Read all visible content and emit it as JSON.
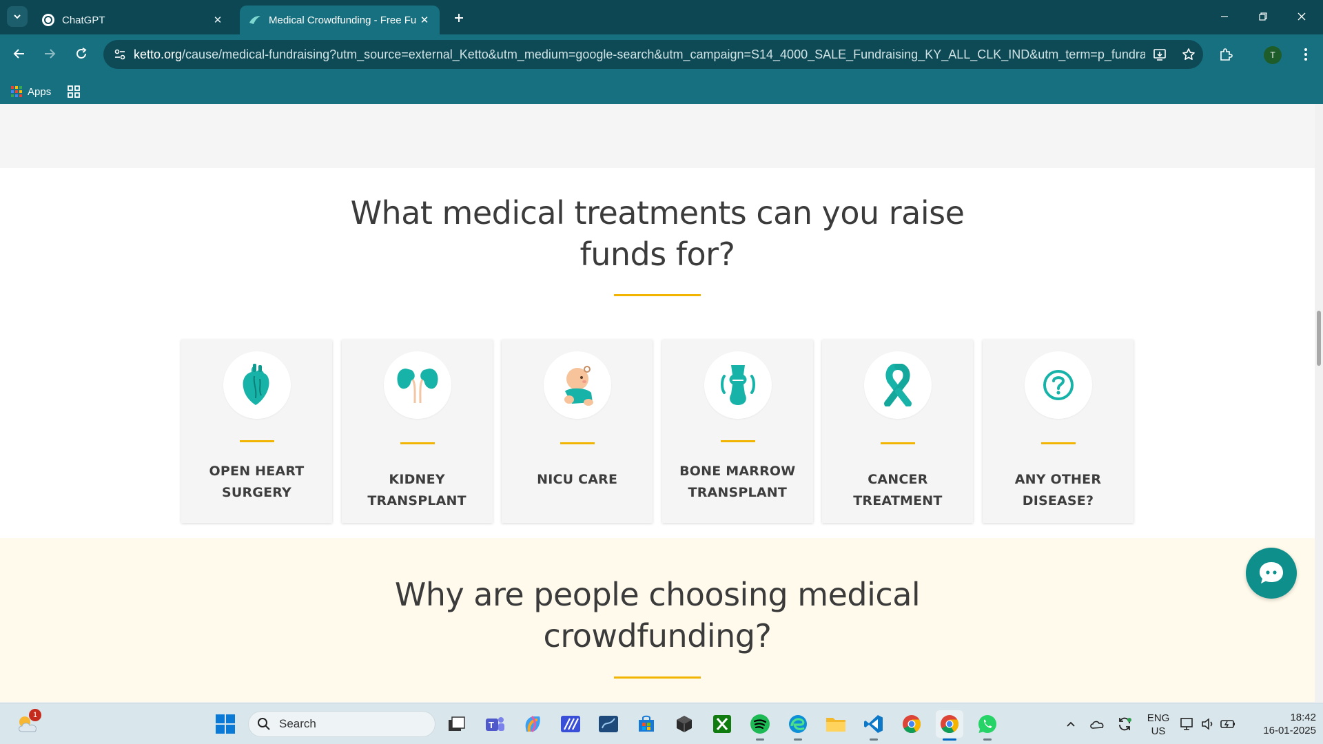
{
  "browser": {
    "tabs": [
      {
        "title": "ChatGPT",
        "active": false
      },
      {
        "title": "Medical Crowdfunding - Free Fu",
        "active": true
      }
    ],
    "url_host": "ketto.org",
    "url_path": "/cause/medical-fundraising?utm_source=external_Ketto&utm_medium=google-search&utm_campaign=S14_4000_SALE_Fundraising_KY_ALL_CLK_IND&utm_term=p_fundraiser&...",
    "profile_initial": "T",
    "bookmarks": {
      "apps_label": "Apps"
    }
  },
  "page": {
    "treatments_heading": "What medical treatments can you raise funds for?",
    "treatments_heading_line1": "What medical treatments can you raise",
    "treatments_heading_line2": "funds for?",
    "treatments": [
      {
        "icon": "heart-icon",
        "line1": "OPEN HEART",
        "line2": "SURGERY"
      },
      {
        "icon": "kidney-icon",
        "line1": "KIDNEY TRANSPLANT",
        "line2": ""
      },
      {
        "icon": "baby-icon",
        "line1": "NICU CARE",
        "line2": ""
      },
      {
        "icon": "bone-icon",
        "line1": "BONE MARROW",
        "line2": "TRANSPLANT"
      },
      {
        "icon": "ribbon-icon",
        "line1": "CANCER TREATMENT",
        "line2": ""
      },
      {
        "icon": "question-icon",
        "line1": "ANY OTHER DISEASE?",
        "line2": ""
      }
    ],
    "why_heading_line1": "Why are people choosing medical",
    "why_heading_line2": "crowdfunding?",
    "accent_color": "#f1b400",
    "brand_teal": "#0f8f8c"
  },
  "taskbar": {
    "search_placeholder": "Search",
    "weather_badge": "1",
    "lang_line1": "ENG",
    "lang_line2": "US",
    "time": "18:42",
    "date": "16-01-2025"
  }
}
